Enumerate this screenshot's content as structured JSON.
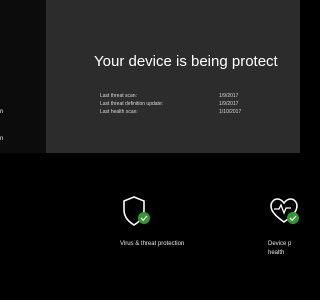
{
  "sidebar": {
    "items": [
      {
        "label": "n"
      },
      {
        "label": "n"
      }
    ]
  },
  "hero": {
    "title": "Your device is being protect",
    "stats": [
      {
        "label": "Last threat scan:",
        "value": "1/9/2017"
      },
      {
        "label": "Last threat definition update:",
        "value": "1/9/2017"
      },
      {
        "label": "Last health scan:",
        "value": "1/10/2017"
      }
    ]
  },
  "tiles": [
    {
      "label": "Virus & threat protection",
      "icon": "shield-check-icon"
    },
    {
      "label": "Device p health",
      "icon": "heart-check-icon"
    }
  ],
  "colors": {
    "background": "#000000",
    "sidebar": "#0c0c0c",
    "hero": "#2c2c2c",
    "status_green": "#2d9a2d"
  }
}
